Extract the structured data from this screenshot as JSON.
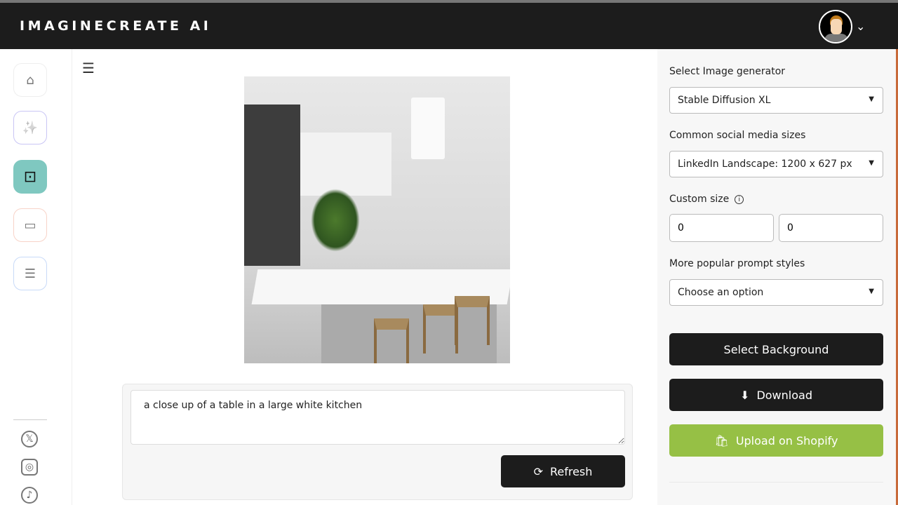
{
  "header": {
    "title": "IMAGINECREATE AI"
  },
  "sidebar": {
    "items": [
      {
        "name": "home",
        "icon": "⌂"
      },
      {
        "name": "magic",
        "icon": "✨"
      },
      {
        "name": "image-generator",
        "icon": "⊡"
      },
      {
        "name": "video",
        "icon": "▭"
      },
      {
        "name": "list",
        "icon": "☰"
      }
    ],
    "active": "image-generator",
    "active_color": "#7fc8c0"
  },
  "social": {
    "x": "𝕏",
    "instagram": "◎",
    "tiktok": "♪"
  },
  "main": {
    "menu_icon": "☰",
    "prompt": "a close up of a table in a large white kitchen",
    "refresh_label": "Refresh",
    "refresh_icon": "⟳"
  },
  "panel": {
    "generator_label": "Select Image generator",
    "generator_value": "Stable Diffusion XL",
    "sizes_label": "Common social media sizes",
    "sizes_value": "LinkedIn Landscape: 1200 x 627 px",
    "custom_label": "Custom size",
    "width": "0",
    "height": "0",
    "styles_label": "More popular prompt styles",
    "styles_value": "Choose an option",
    "select_bg": "Select Background",
    "download": "Download",
    "download_icon": "⬇",
    "shopify": "Upload on Shopify",
    "shopify_icon": "🛍",
    "shopify_color": "#96c045"
  }
}
